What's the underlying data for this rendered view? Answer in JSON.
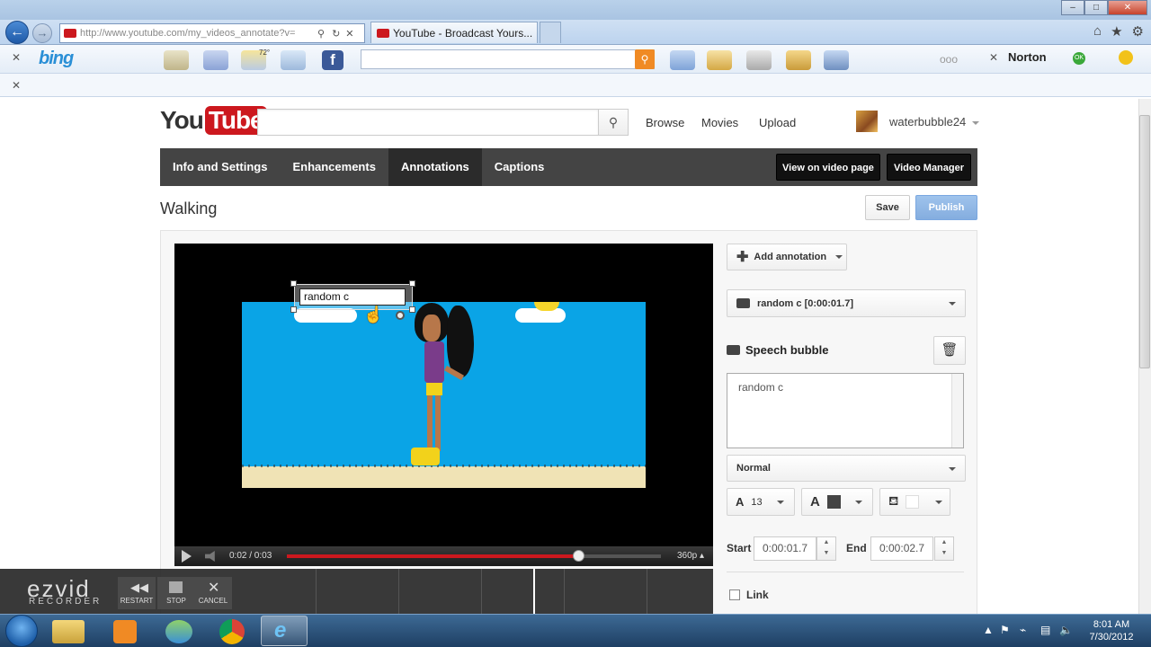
{
  "browser": {
    "url": "http://www.youtube.com/my_videos_annotate?v=",
    "tab_title": "YouTube - Broadcast Yours...",
    "bing_label": "bing",
    "norton_label": "Norton",
    "norton_status": "OK",
    "weather_temp": "72°",
    "tab_close": "×",
    "more_dots": "ooo",
    "icons": [
      "back-icon",
      "forward-icon",
      "search-icon",
      "refresh-icon",
      "stop-icon",
      "home-icon",
      "star-icon",
      "gear-icon"
    ]
  },
  "youtube": {
    "logo_you": "You",
    "logo_tube": "Tube",
    "search_placeholder": "",
    "nav": {
      "browse": "Browse",
      "movies": "Movies",
      "upload": "Upload"
    },
    "username": "waterbubble24",
    "tabs": [
      {
        "label": "Info and Settings"
      },
      {
        "label": "Enhancements"
      },
      {
        "label": "Annotations",
        "active": true
      },
      {
        "label": "Captions"
      }
    ],
    "view_on_video_page": "View on video page",
    "video_manager": "Video Manager",
    "video_title": "Walking",
    "save": "Save",
    "publish": "Publish"
  },
  "player": {
    "annotation_overlay_text": "random c",
    "time_display": "0:02 / 0:03",
    "progress": 0.78,
    "quality": "360p"
  },
  "editor": {
    "add_annotation": "Add annotation",
    "selected_annotation": "random c [0:00:01.7]",
    "type_label": "Speech bubble",
    "annotation_text": "random c",
    "style": "Normal",
    "font_size": "13",
    "start_label": "Start",
    "start_time": "0:00:01.7",
    "end_label": "End",
    "end_time": "0:00:02.7",
    "link_label": "Link",
    "spin_up": "▲",
    "spin_down": "▼"
  },
  "ezvid": {
    "logo": "ezvid",
    "sub": "RECORDER",
    "restart": "RESTART",
    "stop": "STOP",
    "cancel": "CANCEL"
  },
  "taskbar": {
    "time": "8:01 AM",
    "date": "7/30/2012"
  }
}
